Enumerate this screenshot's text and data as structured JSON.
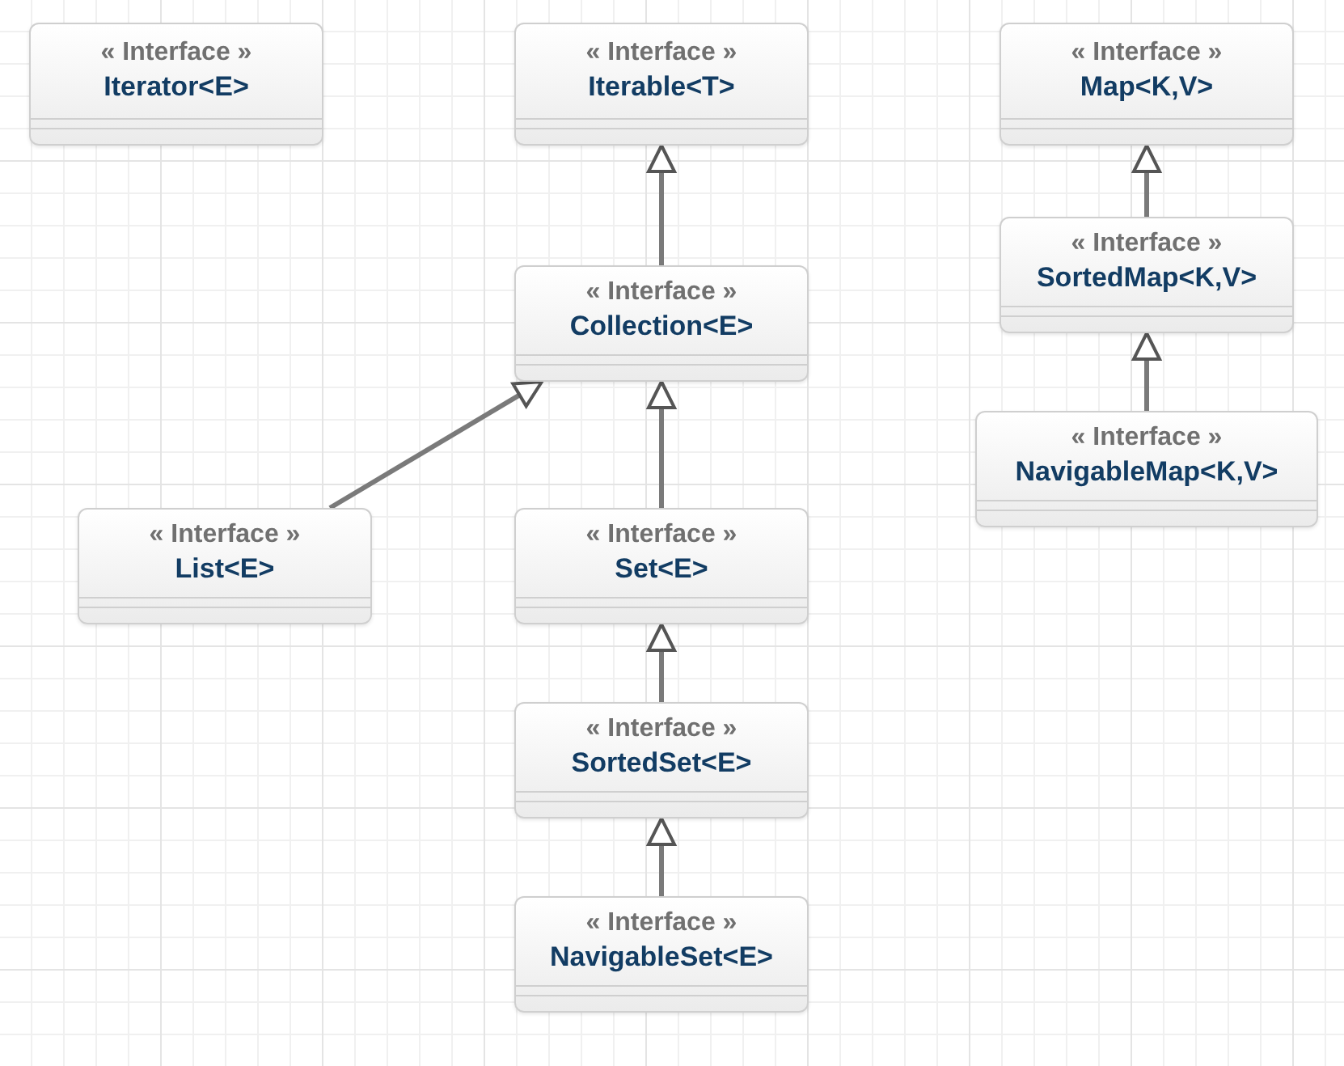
{
  "interfaces": [
    {
      "stereotype": "« Interface »",
      "name": "Iterator<E>"
    },
    {
      "stereotype": "« Interface »",
      "name": "Iterable<T>",
      "children": [
        {
          "stereotype": "« Interface »",
          "name": "Collection<E>",
          "children": [
            {
              "stereotype": "« Interface »",
              "name": "List<E>"
            },
            {
              "stereotype": "« Interface »",
              "name": "Set<E>",
              "children": [
                {
                  "stereotype": "« Interface »",
                  "name": "SortedSet<E>",
                  "children": [
                    {
                      "stereotype": "« Interface »",
                      "name": "NavigableSet<E>"
                    }
                  ]
                }
              ]
            }
          ]
        }
      ]
    },
    {
      "stereotype": "« Interface »",
      "name": "Map<K,V>",
      "children": [
        {
          "stereotype": "« Interface »",
          "name": "SortedMap<K,V>",
          "children": [
            {
              "stereotype": "« Interface »",
              "name": "NavigableMap<K,V>"
            }
          ]
        }
      ]
    }
  ]
}
